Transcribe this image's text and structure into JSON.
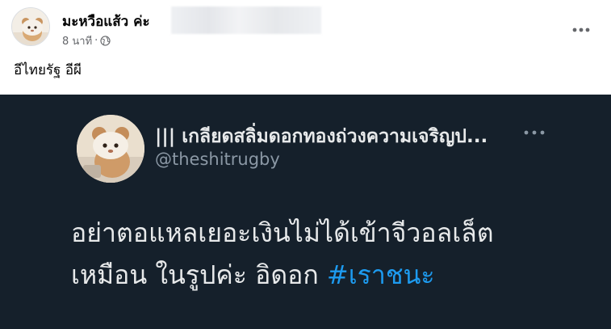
{
  "fb_post": {
    "author_name": "มะหวือแส้ว ค่ะ",
    "time": "8 นาที",
    "separator": "·",
    "privacy_icon": "globe-icon",
    "more_icon": "more-horizontal-icon",
    "text": "อีไทยรัฐ อีผี"
  },
  "tweet": {
    "display_name": "||| เกลียดสลิ่มดอกทองถ่วงความเจริญป...",
    "handle": "@theshitrugby",
    "more_icon": "more-horizontal-icon",
    "body_line1": "อย่าตอแหลเยอะเงินไม่ได้เข้าจีวอลเล็ต",
    "body_line2": "เหมือน ในรูปค่ะ อิดอก ",
    "hashtag": "#เราชนะ"
  },
  "colors": {
    "fb_text": "#050505",
    "fb_secondary": "#65676b",
    "tweet_bg": "#15202b",
    "tweet_text": "#e7e9ea",
    "tweet_secondary": "#8b98a5",
    "link_blue": "#1d9bf0"
  }
}
